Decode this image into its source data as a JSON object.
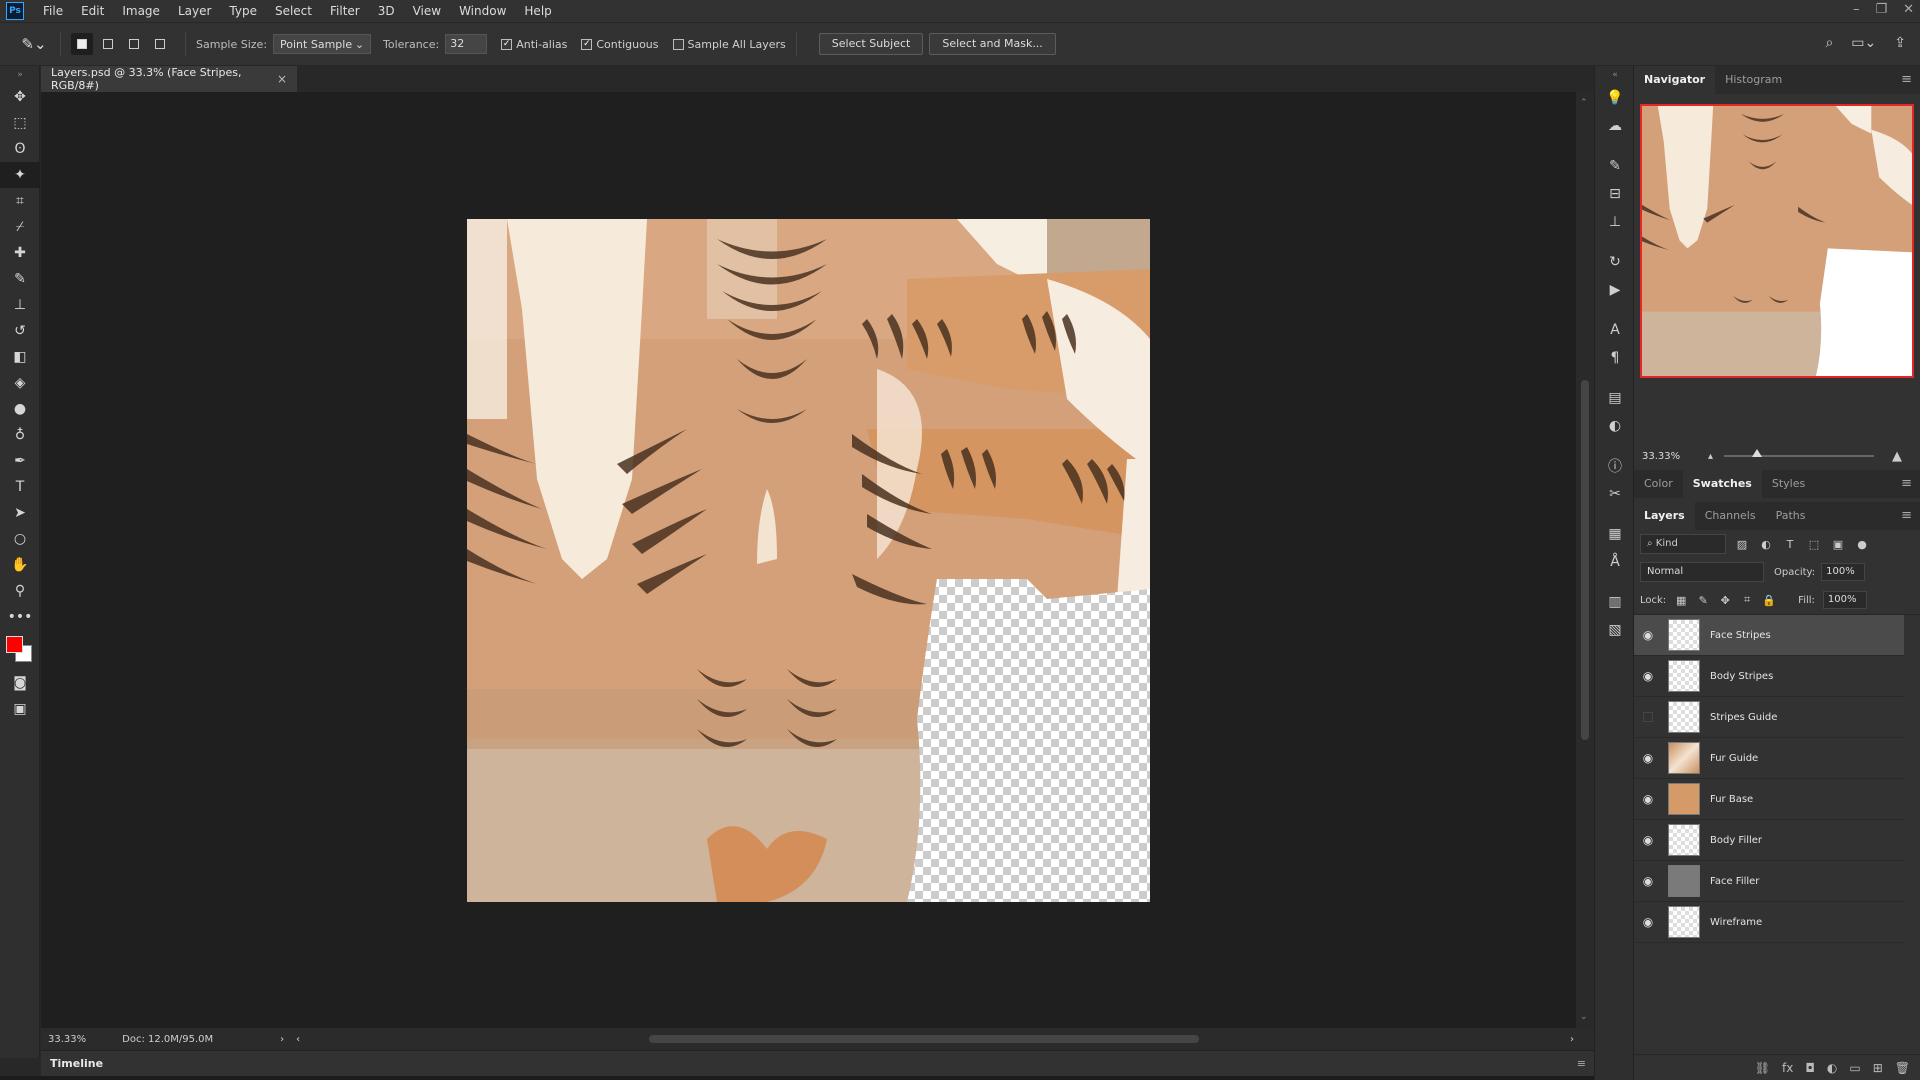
{
  "app": {
    "logo": "Ps"
  },
  "menu": [
    "File",
    "Edit",
    "Image",
    "Layer",
    "Type",
    "Select",
    "Filter",
    "3D",
    "View",
    "Window",
    "Help"
  ],
  "window_controls": [
    "–",
    "❐",
    "✕"
  ],
  "options": {
    "sample_size_label": "Sample Size:",
    "sample_size_value": "Point Sample",
    "tolerance_label": "Tolerance:",
    "tolerance_value": "32",
    "anti_alias": {
      "label": "Anti-alias",
      "checked": true
    },
    "contiguous": {
      "label": "Contiguous",
      "checked": true
    },
    "sample_all_layers": {
      "label": "Sample All Layers",
      "checked": false
    },
    "select_subject": "Select Subject",
    "select_and_mask": "Select and Mask..."
  },
  "document": {
    "tab_title": "Layers.psd @ 33.3% (Face Stripes, RGB/8#)",
    "close": "×"
  },
  "status": {
    "zoom": "33.33%",
    "doc_info": "Doc: 12.0M/95.0M",
    "arrow": "›",
    "prev": "‹",
    "next": "›"
  },
  "timeline": {
    "label": "Timeline"
  },
  "navigator_panel": {
    "tabs": [
      "Navigator",
      "Histogram"
    ],
    "zoom": "33.33%",
    "zoom_level": 0.33
  },
  "color_panel": {
    "tabs": [
      "Color",
      "Swatches",
      "Styles"
    ]
  },
  "layers_panel": {
    "tabs": [
      "Layers",
      "Channels",
      "Paths"
    ],
    "kind": "Kind",
    "blend_mode": "Normal",
    "opacity_label": "Opacity:",
    "opacity_value": "100%",
    "lock_label": "Lock:",
    "fill_label": "Fill:",
    "fill_value": "100%",
    "layers": [
      {
        "name": "Face Stripes",
        "visible": true,
        "selected": true,
        "thumb": "transparent"
      },
      {
        "name": "Body Stripes",
        "visible": true,
        "selected": false,
        "thumb": "transparent"
      },
      {
        "name": "Stripes Guide",
        "visible": false,
        "selected": false,
        "thumb": "transparent"
      },
      {
        "name": "Fur Guide",
        "visible": true,
        "selected": false,
        "thumb": "fur-guide"
      },
      {
        "name": "Fur Base",
        "visible": true,
        "selected": false,
        "thumb": "fur-base"
      },
      {
        "name": "Body Filler",
        "visible": true,
        "selected": false,
        "thumb": "transparent"
      },
      {
        "name": "Face Filler",
        "visible": true,
        "selected": false,
        "thumb": "face-filler"
      },
      {
        "name": "Wireframe",
        "visible": true,
        "selected": false,
        "thumb": "transparent"
      }
    ]
  },
  "colors": {
    "foreground": "#ff0000",
    "background": "#ffffff",
    "nav_frame": "#e52626"
  }
}
